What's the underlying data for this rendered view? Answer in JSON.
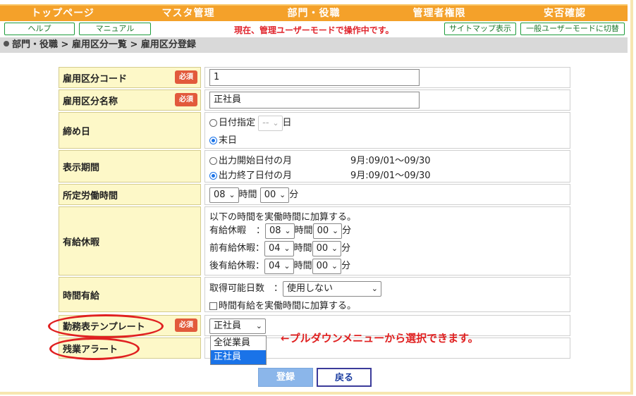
{
  "nav": [
    "トップページ",
    "マスタ管理",
    "部門・役職",
    "管理者権限",
    "安否確認"
  ],
  "subbar": {
    "help": "ヘルプ",
    "manual": "マニュアル",
    "notice": "現在、管理ユーザーモードで操作中です。",
    "sitemap": "サイトマップ表示",
    "switch_mode": "一般ユーザーモードに切替"
  },
  "breadcrumb": "部門・役職 > 雇用区分一覧 > 雇用区分登録",
  "required_label": "必須",
  "form": {
    "code_label": "雇用区分コード",
    "code_value": "1",
    "name_label": "雇用区分名称",
    "name_value": "正社員",
    "closing_label": "締め日",
    "closing_opt1": "日付指定",
    "closing_select": "--",
    "closing_day_unit": "日",
    "closing_opt2": "末日",
    "period_label": "表示期間",
    "period_opt1": "出力開始日付の月",
    "period_opt1_range": "9月:09/01～09/30",
    "period_opt2": "出力終了日付の月",
    "period_opt2_range": "9月:09/01～09/30",
    "workhours_label": "所定労働時間",
    "workhours_hour": "08",
    "hour_unit": "時間",
    "workhours_min": "00",
    "min_unit": "分",
    "paidleave_label": "有給休暇",
    "paidleave_desc": "以下の時間を実働時間に加算する。",
    "paid_full": "有給休暇",
    "paid_full_colon": "：",
    "paid_full_hour": "08",
    "paid_full_min": "00",
    "paid_am": "前有給休暇：",
    "paid_am_hour": "04",
    "paid_am_min": "00",
    "paid_pm": "後有給休暇：",
    "paid_pm_hour": "04",
    "paid_pm_min": "00",
    "hourly_label": "時間有給",
    "hourly_days_label": "取得可能日数　：",
    "hourly_days_value": "使用しない",
    "hourly_check_label": "時間有給を実働時間に加算する。",
    "template_label": "勤務表テンプレート",
    "template_value": "正社員",
    "template_options": [
      "全従業員",
      "正社員"
    ],
    "overtime_label": "残業アラート"
  },
  "annotation": "←プルダウンメニューから選択できます。",
  "buttons": {
    "register": "登録",
    "back": "戻る"
  }
}
